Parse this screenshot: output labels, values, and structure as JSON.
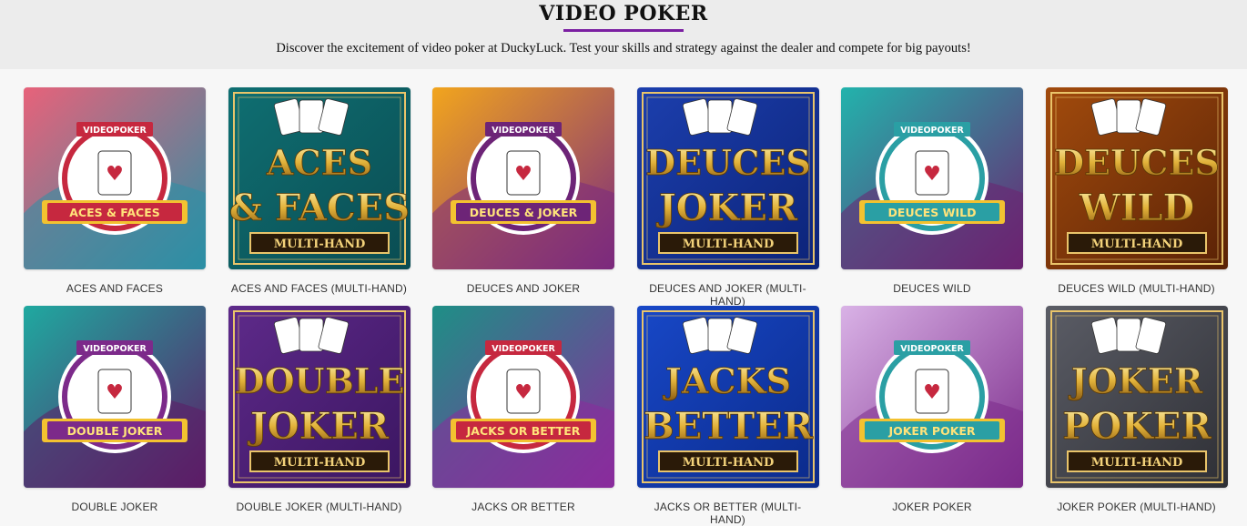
{
  "header": {
    "title": "VIDEO POKER",
    "subtitle": "Discover the excitement of video poker at DuckyLuck. Test your skills and strategy against the dealer and compete for big payouts!"
  },
  "colors": {
    "accent": "#7b1fa2",
    "text": "#111111"
  },
  "games": [
    {
      "name": "ACES AND FACES",
      "style": "badge",
      "bg1": "#e7627a",
      "bg2": "#2c8fa5",
      "banner": "#c6283f",
      "art": [
        "ACES & FACES"
      ],
      "top": "VIDEOPOKER"
    },
    {
      "name": "ACES AND FACES (MULTI-HAND)",
      "style": "gold",
      "bg1": "#0f6f72",
      "bg2": "#0a4c52",
      "art": [
        "ACES",
        "& FACES"
      ],
      "sub": "MULTI-HAND"
    },
    {
      "name": "DEUCES AND JOKER",
      "style": "badge",
      "bg1": "#f2a51d",
      "bg2": "#7b2a7e",
      "banner": "#6d2477",
      "art": [
        "DEUCES & JOKER"
      ],
      "top": "VIDEOPOKER"
    },
    {
      "name": "DEUCES AND JOKER (MULTI-HAND)",
      "style": "gold",
      "bg1": "#1c3fae",
      "bg2": "#0c2378",
      "art": [
        "DEUCES",
        "JOKER"
      ],
      "sub": "MULTI-HAND"
    },
    {
      "name": "DEUCES WILD",
      "style": "badge",
      "bg1": "#22b3ac",
      "bg2": "#6b2371",
      "banner": "#2a9fa4",
      "art": [
        "DEUCES WILD"
      ],
      "top": "VIDEOPOKER"
    },
    {
      "name": "DEUCES WILD (MULTI-HAND)",
      "style": "gold",
      "bg1": "#a24b0d",
      "bg2": "#5a2206",
      "art": [
        "DEUCES",
        "WILD"
      ],
      "sub": "MULTI-HAND"
    },
    {
      "name": "DOUBLE JOKER",
      "style": "badge",
      "bg1": "#1fa9a0",
      "bg2": "#5c1c66",
      "banner": "#7c2a8a",
      "art": [
        "DOUBLE JOKER"
      ],
      "top": "VIDEOPOKER"
    },
    {
      "name": "DOUBLE JOKER (MULTI-HAND)",
      "style": "gold",
      "bg1": "#5e2a8a",
      "bg2": "#3a1560",
      "art": [
        "DOUBLE",
        "JOKER"
      ],
      "sub": "MULTI-HAND"
    },
    {
      "name": "JACKS OR BETTER",
      "style": "badge",
      "bg1": "#1e8f86",
      "bg2": "#8a2b9d",
      "banner": "#c6283f",
      "art": [
        "JACKS OR BETTER"
      ],
      "top": "VIDEOPOKER"
    },
    {
      "name": "JACKS OR BETTER (MULTI-HAND)",
      "style": "gold",
      "bg1": "#1848c8",
      "bg2": "#0b2a8a",
      "art": [
        "JACKS",
        "BETTER"
      ],
      "sub": "MULTI-HAND"
    },
    {
      "name": "JOKER POKER",
      "style": "badge",
      "bg1": "#d9b2e6",
      "bg2": "#7b2a8a",
      "banner": "#2a9fa4",
      "art": [
        "JOKER POKER"
      ],
      "top": "VIDEOPOKER"
    },
    {
      "name": "JOKER POKER (MULTI-HAND)",
      "style": "gold",
      "bg1": "#5b5d66",
      "bg2": "#2e2f35",
      "art": [
        "JOKER",
        "POKER"
      ],
      "sub": "MULTI-HAND"
    }
  ]
}
